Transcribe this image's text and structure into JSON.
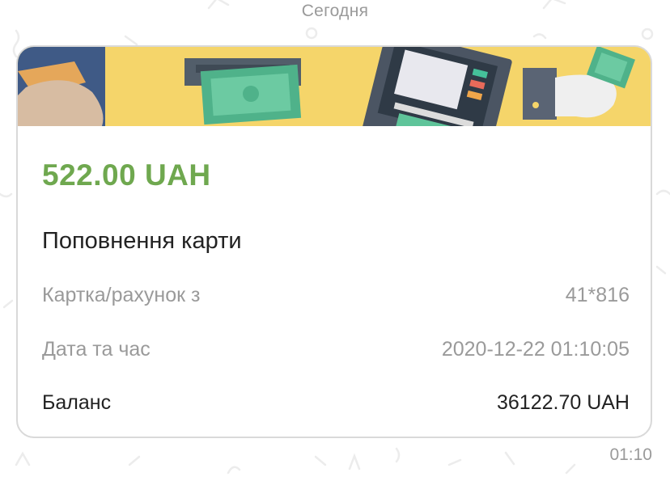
{
  "chat": {
    "date_separator": "Сегодня",
    "message_time": "01:10"
  },
  "transaction": {
    "amount": "522.00 UAH",
    "title": "Поповнення карти",
    "rows": [
      {
        "label": "Картка/рахунок з",
        "value": "41*816"
      },
      {
        "label": "Дата та час",
        "value": "2020-12-22 01:10:05"
      },
      {
        "label": "Баланс",
        "value": "36122.70 UAH"
      }
    ]
  },
  "colors": {
    "amount": "#6fa84f",
    "banner": "#f5d56a",
    "muted_text": "#9a9a9a",
    "dark_text": "#222222"
  },
  "icons": {
    "banner": "cash-atm-illustration"
  }
}
